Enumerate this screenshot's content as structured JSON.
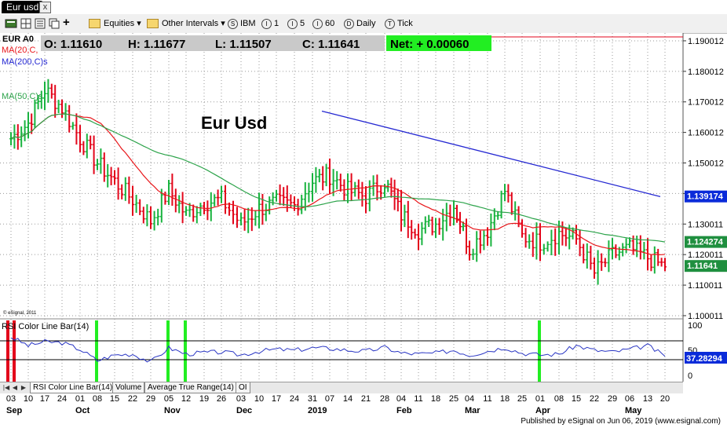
{
  "window": {
    "title": "Eur usd",
    "close_label": "x"
  },
  "toolbar": {
    "equities": "Equities",
    "other_intervals": "Other Intervals",
    "intervals": [
      {
        "key": "S",
        "label": "IBM"
      },
      {
        "key": "I",
        "label": "1"
      },
      {
        "key": "I",
        "label": "5"
      },
      {
        "key": "I",
        "label": "60"
      },
      {
        "key": "D",
        "label": "Daily"
      },
      {
        "key": "T",
        "label": "Tick"
      }
    ]
  },
  "quote": {
    "symbol": "EUR A0",
    "open": "O: 1.11610",
    "high": "H: 1.11677",
    "low": "L: 1.11507",
    "close": "C: 1.11641",
    "net": "Net: + 0.00060"
  },
  "legend": {
    "ma20": "MA(20,C,",
    "ma200": "MA(200,C)s",
    "ma50": "MA(50,C)s"
  },
  "annotation": "Eur Usd",
  "copyright": "© eSignal, 2011",
  "rsi": {
    "label": "RSI Color Line Bar(14)",
    "last": "37.28294",
    "ticks": [
      "100",
      "50",
      "0"
    ]
  },
  "tabs": [
    "RSI Color Line Bar(14)",
    "Volume",
    "Average True Range(14)",
    "OI"
  ],
  "footer": "Published by eSignal on Jun 06, 2019 (www.esignal.com)",
  "colors": {
    "up": "#19b33f",
    "down": "#e3061b",
    "ma20": "#e8161a",
    "ma50": "#2ca34a",
    "ma200": "#2528d2",
    "rsi": "#2a36c4",
    "net_bg": "#22ee22",
    "accent_blue": "#0a2bd9"
  },
  "chart_data": {
    "type": "bar",
    "title": "Eur Usd",
    "symbol": "EUR A0",
    "y_tick_labels": [
      "1.190012",
      "1.180012",
      "1.170012",
      "1.160012",
      "1.150012",
      "1.140012",
      "1.130011",
      "1.120011",
      "1.110011",
      "1.100011"
    ],
    "ylim": [
      1.1,
      1.19
    ],
    "x_tick_labels": [
      "03",
      "10",
      "17",
      "24",
      "01",
      "08",
      "15",
      "22",
      "29",
      "05",
      "12",
      "19",
      "26",
      "03",
      "10",
      "17",
      "24",
      "31",
      "07",
      "14",
      "21",
      "28",
      "04",
      "11",
      "18",
      "25",
      "04",
      "11",
      "18",
      "25",
      "01",
      "08",
      "15",
      "22",
      "29",
      "06",
      "13",
      "20"
    ],
    "month_labels": [
      {
        "label": "Sep",
        "index": 0
      },
      {
        "label": "Oct",
        "index": 4
      },
      {
        "label": "Nov",
        "index": 9
      },
      {
        "label": "Dec",
        "index": 13
      },
      {
        "label": "2019",
        "index": 17
      },
      {
        "label": "Feb",
        "index": 22
      },
      {
        "label": "Mar",
        "index": 26
      },
      {
        "label": "Apr",
        "index": 30
      },
      {
        "label": "May",
        "index": 35
      }
    ],
    "price_labels": [
      {
        "value": 1.139174,
        "label": "1.139174",
        "series": "MA(200)"
      },
      {
        "value": 1.124274,
        "label": "1.124274",
        "series": "MA(50)"
      },
      {
        "value": 1.11641,
        "label": "1.11641",
        "series": "Close"
      }
    ],
    "weekly_close": [
      1.158,
      1.163,
      1.174,
      1.168,
      1.158,
      1.15,
      1.144,
      1.138,
      1.131,
      1.141,
      1.133,
      1.137,
      1.138,
      1.13,
      1.135,
      1.137,
      1.136,
      1.144,
      1.146,
      1.141,
      1.139,
      1.144,
      1.133,
      1.128,
      1.13,
      1.136,
      1.122,
      1.128,
      1.141,
      1.126,
      1.124,
      1.127,
      1.125,
      1.114,
      1.12,
      1.122,
      1.119,
      1.116
    ],
    "ma200": {
      "x_start": 18,
      "x_end": 37,
      "start": 1.167,
      "end": 1.139
    },
    "rsi_weekly": [
      78,
      60,
      68,
      66,
      52,
      28,
      40,
      42,
      25,
      55,
      42,
      45,
      46,
      40,
      48,
      52,
      50,
      55,
      54,
      50,
      48,
      56,
      44,
      42,
      44,
      50,
      40,
      48,
      56,
      44,
      40,
      42,
      60,
      50,
      46,
      52,
      60,
      37
    ],
    "rsi_ylim": [
      0,
      100
    ],
    "rsi_green_markers": [
      5,
      9,
      10,
      30
    ],
    "rsi_red_markers": [
      0
    ]
  }
}
